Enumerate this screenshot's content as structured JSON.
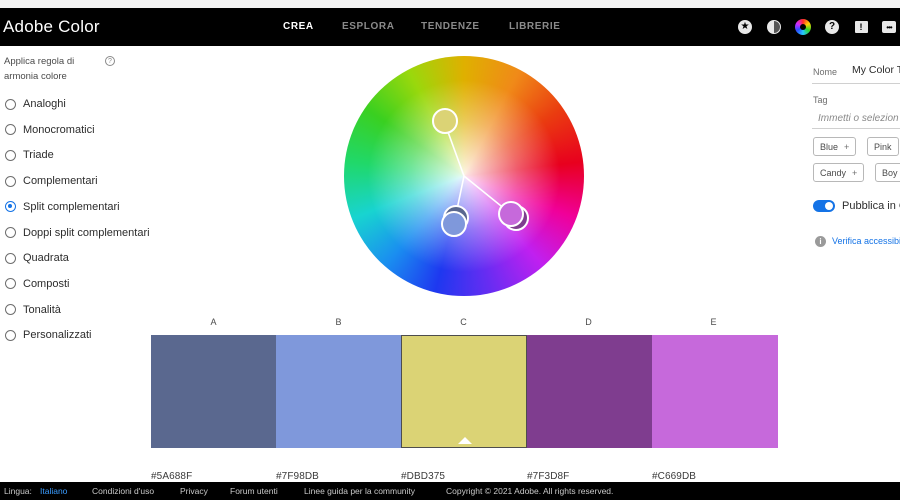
{
  "app": {
    "title": "Adobe Color"
  },
  "nav": {
    "tabs": [
      "CREA",
      "ESPLORA",
      "TENDENZE",
      "LIBRERIE"
    ],
    "active": "CREA"
  },
  "header_icons": [
    "star-badge-icon",
    "theme-toggle-icon",
    "color-wheel-icon",
    "help-icon",
    "feedback-icon",
    "chat-icon"
  ],
  "harmony": {
    "title": "Applica regola di armonia colore",
    "help_symbol": "?",
    "selected": "Split complementari",
    "rules": [
      "Analoghi",
      "Monocromatici",
      "Triade",
      "Complementari",
      "Split complementari",
      "Doppi split complementari",
      "Quadrata",
      "Composti",
      "Tonalità",
      "Personalizzati"
    ]
  },
  "palette": {
    "selected_index": 2,
    "swatches": [
      {
        "label": "A",
        "hex": "#5A688F",
        "color": "#5A688F"
      },
      {
        "label": "B",
        "hex": "#7F98DB",
        "color": "#7F98DB"
      },
      {
        "label": "C",
        "hex": "#DBD375",
        "color": "#DBD375"
      },
      {
        "label": "D",
        "hex": "#7F3D8F",
        "color": "#7F3D8F"
      },
      {
        "label": "E",
        "hex": "#C669DB",
        "color": "#C669DB"
      }
    ]
  },
  "right_panel": {
    "name_label": "Nome",
    "name_value": "My Color T",
    "tag_label": "Tag",
    "tag_placeholder": "Immetti o selezion",
    "tags": [
      "Blue",
      "Pink",
      "Candy",
      "Boy"
    ],
    "tag_add_symbol": "+",
    "publish_label": "Pubblica in C",
    "publish_enabled": true,
    "info_symbol": "i",
    "accessibility_link": "Verifica accessibil"
  },
  "footer": {
    "language_label": "Lingua:",
    "language_value": "Italiano",
    "links": [
      "Condizioni d'uso",
      "Privacy",
      "Forum utenti",
      "Linee guida per la community"
    ],
    "copyright": "Copyright © 2021 Adobe. All rights reserved."
  },
  "colors": {
    "accent": "#1473e6",
    "header_bg": "#000000",
    "footer_bg": "#000000"
  }
}
